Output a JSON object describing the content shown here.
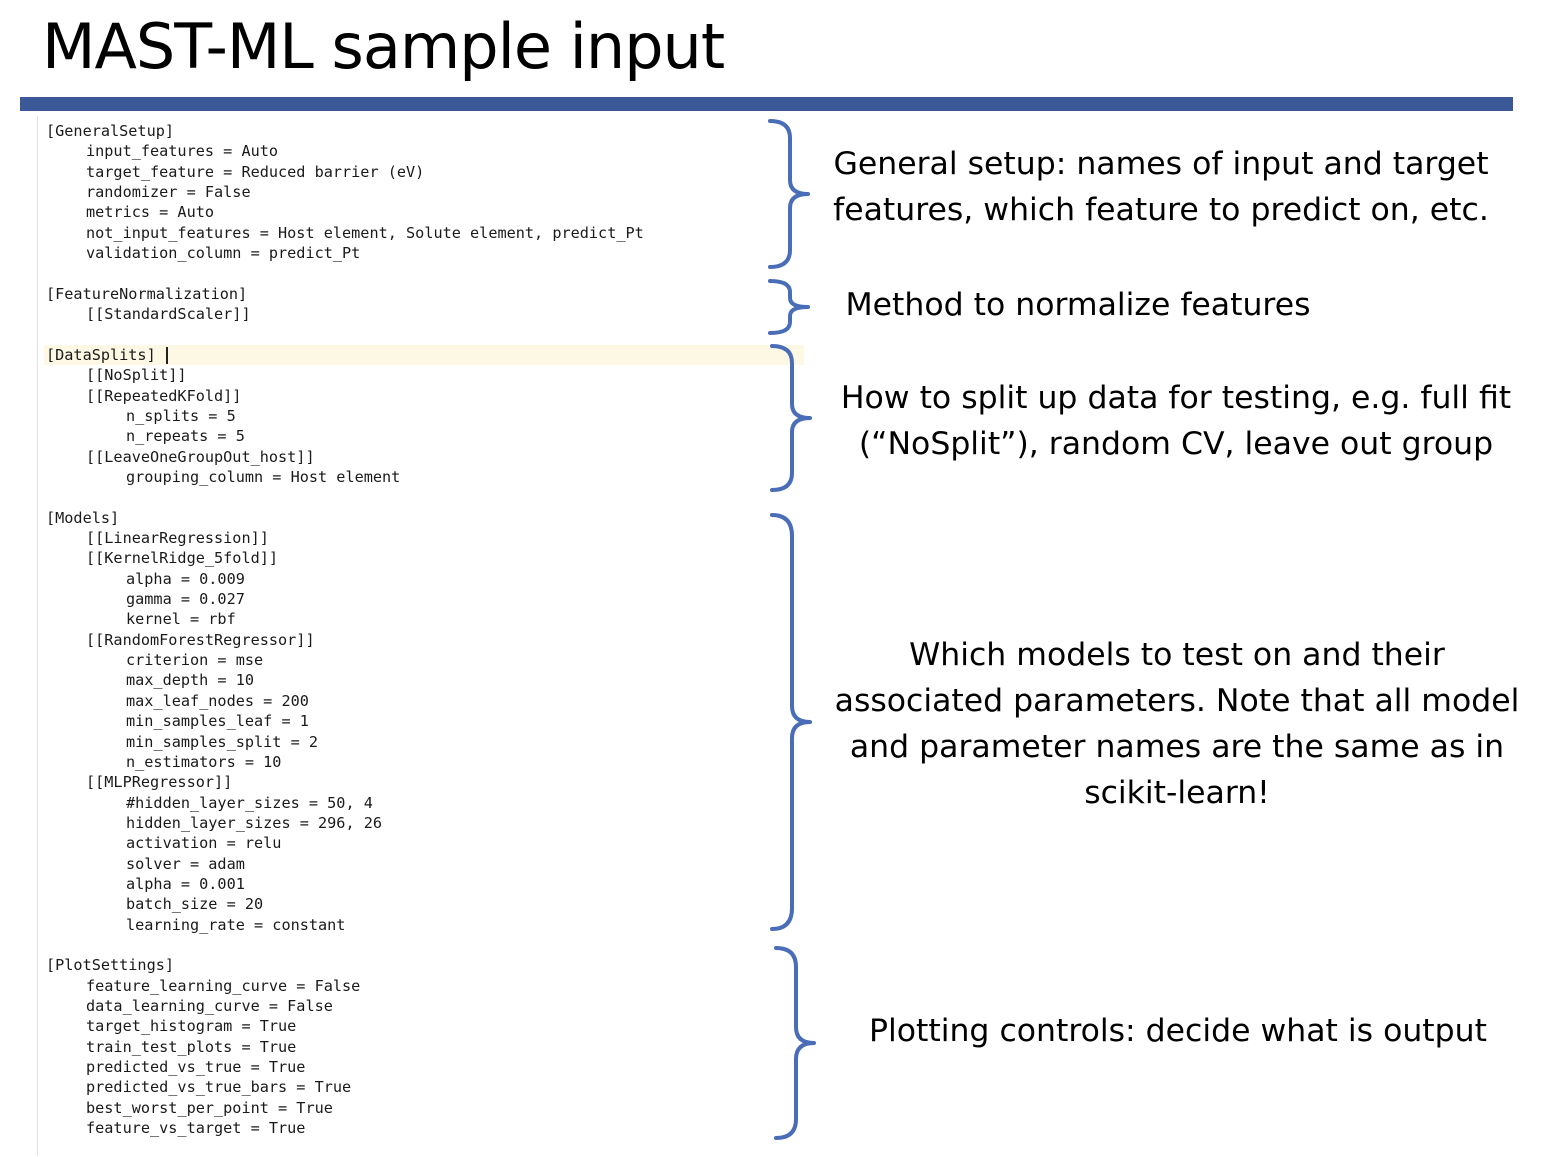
{
  "slide": {
    "title": "MAST-ML sample input",
    "accent_color": "#3b5897",
    "brace_color": "#4a6db7"
  },
  "editor": {
    "lines": [
      {
        "indent": 0,
        "text": "[GeneralSetup]"
      },
      {
        "indent": 1,
        "text": "input_features = Auto"
      },
      {
        "indent": 1,
        "text": "target_feature = Reduced barrier (eV)"
      },
      {
        "indent": 1,
        "text": "randomizer = False"
      },
      {
        "indent": 1,
        "text": "metrics = Auto"
      },
      {
        "indent": 1,
        "text": "not_input_features = Host element, Solute element, predict_Pt"
      },
      {
        "indent": 1,
        "text": "validation_column = predict_Pt"
      },
      {
        "indent": 0,
        "text": ""
      },
      {
        "indent": 0,
        "text": "[FeatureNormalization]"
      },
      {
        "indent": 1,
        "text": "[[StandardScaler]]"
      },
      {
        "indent": 0,
        "text": ""
      },
      {
        "indent": 0,
        "text": "[DataSplits]"
      },
      {
        "indent": 1,
        "text": "[[NoSplit]]"
      },
      {
        "indent": 1,
        "text": "[[RepeatedKFold]]"
      },
      {
        "indent": 2,
        "text": "n_splits = 5"
      },
      {
        "indent": 2,
        "text": "n_repeats = 5"
      },
      {
        "indent": 1,
        "text": "[[LeaveOneGroupOut_host]]"
      },
      {
        "indent": 2,
        "text": "grouping_column = Host element"
      },
      {
        "indent": 0,
        "text": ""
      },
      {
        "indent": 0,
        "text": "[Models]"
      },
      {
        "indent": 1,
        "text": "[[LinearRegression]]"
      },
      {
        "indent": 1,
        "text": "[[KernelRidge_5fold]]"
      },
      {
        "indent": 2,
        "text": "alpha = 0.009"
      },
      {
        "indent": 2,
        "text": "gamma = 0.027"
      },
      {
        "indent": 2,
        "text": "kernel = rbf"
      },
      {
        "indent": 1,
        "text": "[[RandomForestRegressor]]"
      },
      {
        "indent": 2,
        "text": "criterion = mse"
      },
      {
        "indent": 2,
        "text": "max_depth = 10"
      },
      {
        "indent": 2,
        "text": "max_leaf_nodes = 200"
      },
      {
        "indent": 2,
        "text": "min_samples_leaf = 1"
      },
      {
        "indent": 2,
        "text": "min_samples_split = 2"
      },
      {
        "indent": 2,
        "text": "n_estimators = 10"
      },
      {
        "indent": 1,
        "text": "[[MLPRegressor]]"
      },
      {
        "indent": 2,
        "text": "#hidden_layer_sizes = 50, 4"
      },
      {
        "indent": 2,
        "text": "hidden_layer_sizes = 296, 26"
      },
      {
        "indent": 2,
        "text": "activation = relu"
      },
      {
        "indent": 2,
        "text": "solver = adam"
      },
      {
        "indent": 2,
        "text": "alpha = 0.001"
      },
      {
        "indent": 2,
        "text": "batch_size = 20"
      },
      {
        "indent": 2,
        "text": "learning_rate = constant"
      },
      {
        "indent": 0,
        "text": ""
      },
      {
        "indent": 0,
        "text": "[PlotSettings]"
      },
      {
        "indent": 1,
        "text": "feature_learning_curve = False"
      },
      {
        "indent": 1,
        "text": "data_learning_curve = False"
      },
      {
        "indent": 1,
        "text": "target_histogram = True"
      },
      {
        "indent": 1,
        "text": "train_test_plots = True"
      },
      {
        "indent": 1,
        "text": "predicted_vs_true = True"
      },
      {
        "indent": 1,
        "text": "predicted_vs_true_bars = True"
      },
      {
        "indent": 1,
        "text": "best_worst_per_point = True"
      },
      {
        "indent": 1,
        "text": "feature_vs_target = True"
      }
    ]
  },
  "annotations": {
    "general_setup": [
      "General setup: names of input and target",
      "features, which feature to predict on, etc."
    ],
    "normalization": [
      "Method to normalize features"
    ],
    "data_splits": [
      "How to split up data for testing, e.g. full fit",
      "(“NoSplit”), random CV, leave out group"
    ],
    "models": [
      "Which models to test on and their",
      "associated parameters. Note that all model",
      "and parameter names are the same as in",
      "scikit-learn!"
    ],
    "plot_settings": [
      "Plotting controls: decide what is output"
    ]
  }
}
